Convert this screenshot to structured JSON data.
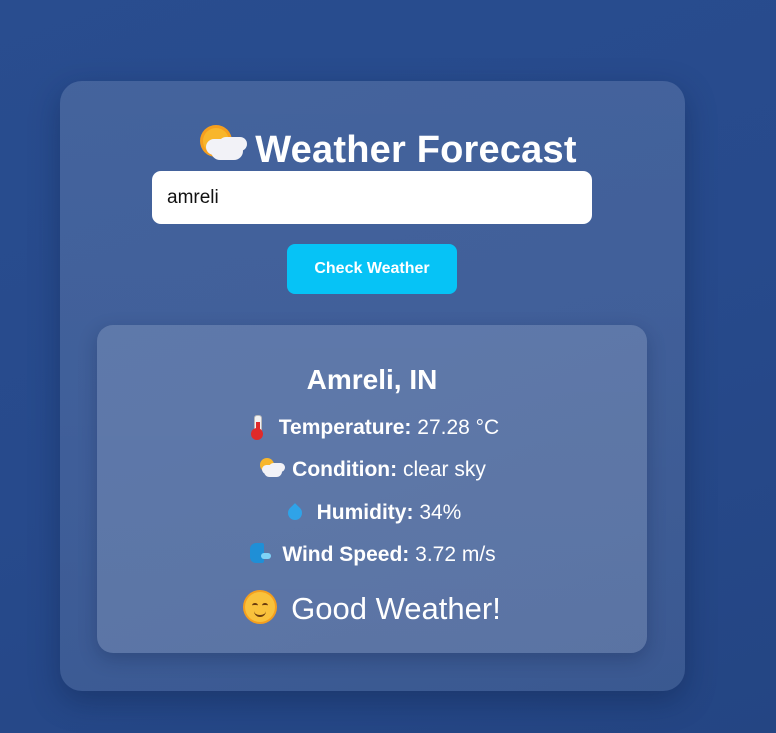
{
  "app": {
    "title": "Weather Forecast",
    "title_icon": "sun-behind-cloud-icon"
  },
  "search": {
    "value": "amreli",
    "button_label": "Check Weather"
  },
  "result": {
    "city": "Amreli, IN",
    "temperature": {
      "icon": "thermometer-icon",
      "label": "Temperature:",
      "value": "27.28 °C"
    },
    "condition": {
      "icon": "sun-behind-cloud-icon",
      "label": "Condition:",
      "value": "clear sky"
    },
    "humidity": {
      "icon": "droplet-icon",
      "label": "Humidity:",
      "value": "34%"
    },
    "wind": {
      "icon": "wind-face-icon",
      "label": "Wind Speed:",
      "value": "3.72 m/s"
    },
    "verdict": {
      "icon": "smiling-face-icon",
      "text": "Good Weather!"
    }
  },
  "colors": {
    "background": "#274a8c",
    "button": "#06c3f6",
    "text": "#ffffff"
  }
}
